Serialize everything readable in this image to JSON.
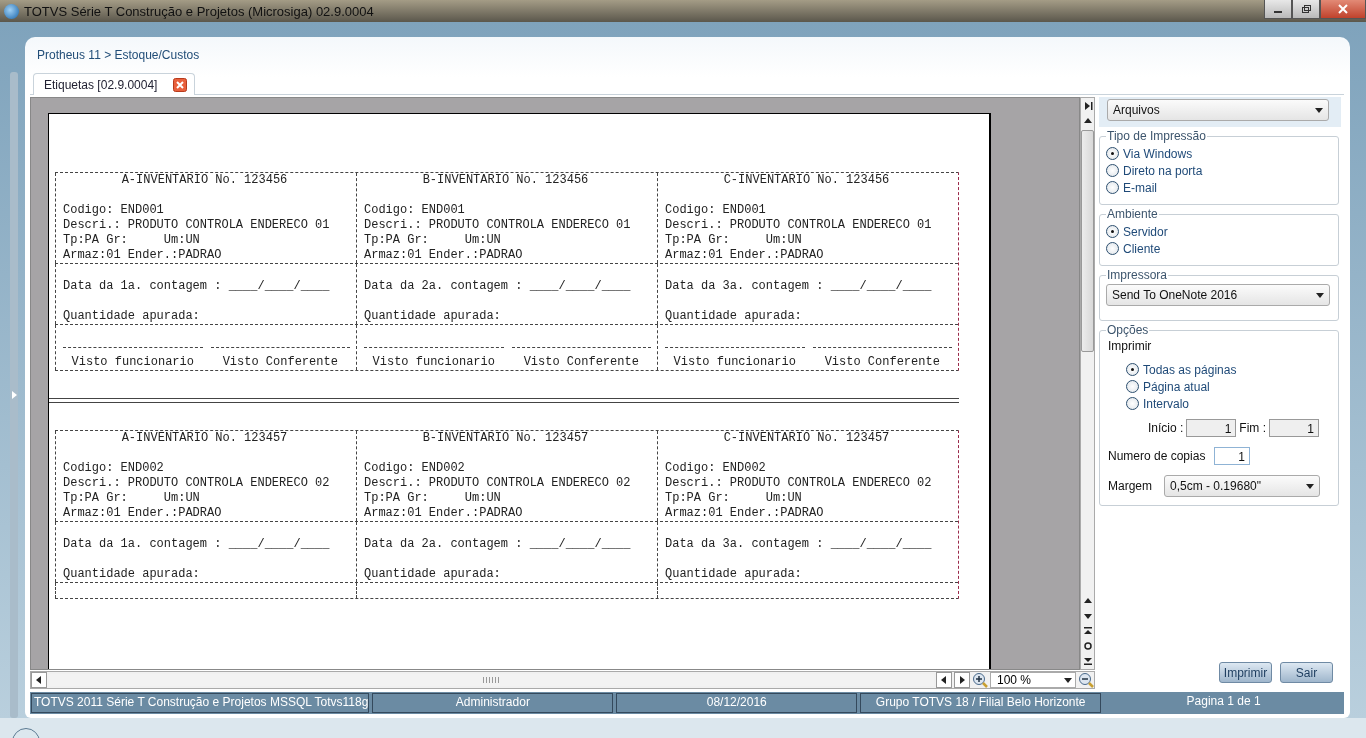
{
  "window": {
    "title": "TOTVS Série T Construção e Projetos (Microsiga) 02.9.0004"
  },
  "breadcrumb": "Protheus 11 > Estoque/Custos",
  "tabs": [
    {
      "label": "Etiquetas [02.9.0004]",
      "selected": true
    }
  ],
  "report": {
    "blocks": [
      {
        "cards": [
          {
            "title": "A-INVENTARIO No. 123456",
            "fields": [
              "Codigo: END001",
              "Descri.: PRODUTO CONTROLA ENDERECO 01",
              "Tp:PA Gr:     Um:UN",
              "Armaz:01 Ender.:PADRAO"
            ],
            "date_line": "Data da 1a. contagem : ____/____/____",
            "quantity_line": "Quantidade apurada:",
            "signatures": [
              "Visto funcionario",
              "Visto Conferente"
            ]
          },
          {
            "title": "B-INVENTARIO No. 123456",
            "fields": [
              "Codigo: END001",
              "Descri.: PRODUTO CONTROLA ENDERECO 01",
              "Tp:PA Gr:     Um:UN",
              "Armaz:01 Ender.:PADRAO"
            ],
            "date_line": "Data da 2a. contagem : ____/____/____",
            "quantity_line": "Quantidade apurada:",
            "signatures": [
              "Visto funcionario",
              "Visto Conferente"
            ]
          },
          {
            "title": "C-INVENTARIO No. 123456",
            "fields": [
              "Codigo: END001",
              "Descri.: PRODUTO CONTROLA ENDERECO 01",
              "Tp:PA Gr:     Um:UN",
              "Armaz:01 Ender.:PADRAO"
            ],
            "date_line": "Data da 3a. contagem : ____/____/____",
            "quantity_line": "Quantidade apurada:",
            "signatures": [
              "Visto funcionario",
              "Visto Conferente"
            ]
          }
        ]
      },
      {
        "cards": [
          {
            "title": "A-INVENTARIO No. 123457",
            "fields": [
              "Codigo: END002",
              "Descri.: PRODUTO CONTROLA ENDERECO 02",
              "Tp:PA Gr:     Um:UN",
              "Armaz:01 Ender.:PADRAO"
            ],
            "date_line": "Data da 1a. contagem : ____/____/____",
            "quantity_line": "Quantidade apurada:"
          },
          {
            "title": "B-INVENTARIO No. 123457",
            "fields": [
              "Codigo: END002",
              "Descri.: PRODUTO CONTROLA ENDERECO 02",
              "Tp:PA Gr:     Um:UN",
              "Armaz:01 Ender.:PADRAO"
            ],
            "date_line": "Data da 2a. contagem : ____/____/____",
            "quantity_line": "Quantidade apurada:"
          },
          {
            "title": "C-INVENTARIO No. 123457",
            "fields": [
              "Codigo: END002",
              "Descri.: PRODUTO CONTROLA ENDERECO 02",
              "Tp:PA Gr:     Um:UN",
              "Armaz:01 Ender.:PADRAO"
            ],
            "date_line": "Data da 3a. contagem : ____/____/____",
            "quantity_line": "Quantidade apurada:"
          }
        ]
      }
    ]
  },
  "zoom": {
    "value": "100 %"
  },
  "panel": {
    "file_select": "Arquivos",
    "print_type": {
      "legend": "Tipo de Impressão",
      "options": [
        {
          "label": "Via Windows",
          "selected": true
        },
        {
          "label": "Direto na porta",
          "selected": false
        },
        {
          "label": "E-mail",
          "selected": false
        }
      ]
    },
    "environment": {
      "legend": "Ambiente",
      "options": [
        {
          "label": "Servidor",
          "selected": true
        },
        {
          "label": "Cliente",
          "selected": false
        }
      ]
    },
    "printer": {
      "legend": "Impressora",
      "value": "Send To OneNote 2016"
    },
    "options": {
      "legend": "Opções",
      "print_label": "Imprimir",
      "pages": [
        {
          "label": "Todas as páginas",
          "selected": true
        },
        {
          "label": "Página atual",
          "selected": false
        },
        {
          "label": "Intervalo",
          "selected": false
        }
      ],
      "start_label": "Início :",
      "start_value": "1",
      "end_label": "Fim :",
      "end_value": "1",
      "copies_label": "Numero de copias",
      "copies_value": "1",
      "margin_label": "Margem",
      "margin_value": "0,5cm - 0.19680\""
    },
    "buttons": [
      "Imprimir",
      "Sair"
    ]
  },
  "status_bar": [
    "TOTVS 2011 Série T Construção e Projetos MSSQL Totvs118g",
    "Administrador",
    "08/12/2016",
    "Grupo TOTVS 18 / Filial Belo Horizonte",
    "Pagina 1 de 1"
  ]
}
